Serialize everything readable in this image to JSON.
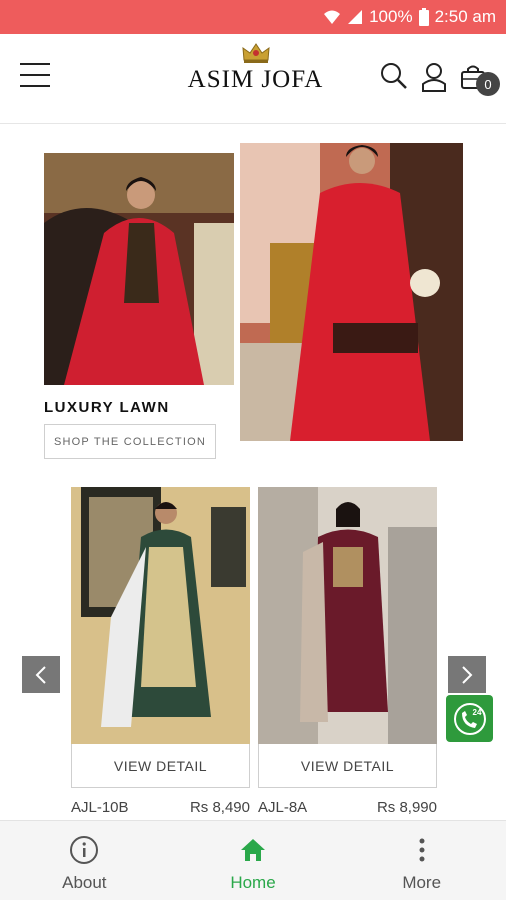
{
  "status_bar": {
    "battery": "100%",
    "time": "2:50 am"
  },
  "header": {
    "logo_text": "ASIM JOFA",
    "cart_count": "0"
  },
  "banner": {
    "title": "LUXURY LAWN",
    "button_label": "SHOP THE COLLECTION"
  },
  "products": [
    {
      "view_label": "VIEW DETAIL",
      "code": "AJL-10B",
      "price": "Rs 8,490"
    },
    {
      "view_label": "VIEW DETAIL",
      "code": "AJL-8A",
      "price": "Rs 8,990"
    }
  ],
  "call_badge": "24",
  "bottom_nav": [
    {
      "label": "About",
      "icon": "info-icon"
    },
    {
      "label": "Home",
      "icon": "home-icon",
      "active": true
    },
    {
      "label": "More",
      "icon": "more-vertical-icon"
    }
  ],
  "colors": {
    "status_bar": "#ee5c5c",
    "active_nav": "#2aa84a",
    "call_button": "#2e9a3c"
  }
}
